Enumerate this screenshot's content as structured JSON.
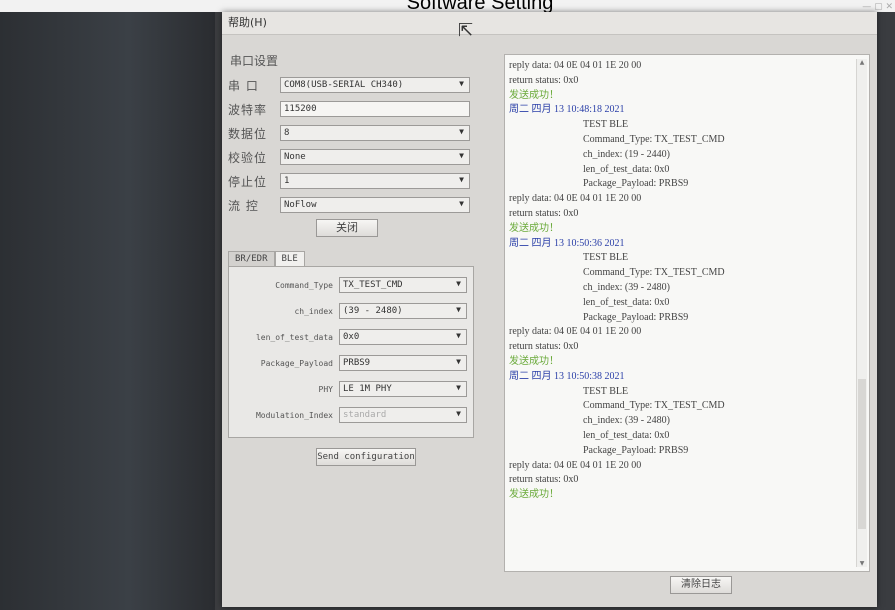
{
  "window": {
    "title": "Software Setting"
  },
  "menubar": {
    "help": "帮助(H)"
  },
  "serial": {
    "group_title": "串口设置",
    "port_label": "串  口",
    "port_value": "COM8(USB-SERIAL CH340)",
    "baud_label": "波特率",
    "baud_value": "115200",
    "databits_label": "数据位",
    "databits_value": "8",
    "parity_label": "校验位",
    "parity_value": "None",
    "stopbits_label": "停止位",
    "stopbits_value": "1",
    "flow_label": "流  控",
    "flow_value": "NoFlow",
    "close_button": "关闭"
  },
  "tabs": [
    {
      "label": "BR/EDR"
    },
    {
      "label": "BLE"
    }
  ],
  "ble": {
    "fields": [
      {
        "label": "Command_Type",
        "value": "TX_TEST_CMD"
      },
      {
        "label": "ch_index",
        "value": "(39 - 2480)"
      },
      {
        "label": "len_of_test_data",
        "value": "0x0"
      },
      {
        "label": "Package_Payload",
        "value": "PRBS9"
      },
      {
        "label": "PHY",
        "value": "LE 1M PHY"
      },
      {
        "label": "Modulation_Index",
        "value": "standard"
      }
    ],
    "send_button": "Send configuration"
  },
  "log": {
    "lines": [
      {
        "text": "reply data: 04 0E 04 01 1E 20 00",
        "kind": "normal"
      },
      {
        "text": "return status: 0x0",
        "kind": "normal"
      },
      {
        "text": "发送成功！",
        "kind": "ok"
      },
      {
        "text": "周二 四月 13 10:48:18 2021",
        "kind": "ts"
      },
      {
        "text": "TEST BLE",
        "kind": "indent"
      },
      {
        "text": "Command_Type: TX_TEST_CMD",
        "kind": "indent"
      },
      {
        "text": "ch_index: (19 - 2440)",
        "kind": "indent"
      },
      {
        "text": "len_of_test_data: 0x0",
        "kind": "indent"
      },
      {
        "text": "Package_Payload: PRBS9",
        "kind": "indent"
      },
      {
        "text": "reply data: 04 0E 04 01 1E 20 00",
        "kind": "normal"
      },
      {
        "text": "return status: 0x0",
        "kind": "normal"
      },
      {
        "text": "发送成功！",
        "kind": "ok"
      },
      {
        "text": "周二 四月 13 10:50:36 2021",
        "kind": "ts"
      },
      {
        "text": "TEST BLE",
        "kind": "indent"
      },
      {
        "text": "Command_Type: TX_TEST_CMD",
        "kind": "indent"
      },
      {
        "text": "ch_index: (39 - 2480)",
        "kind": "indent"
      },
      {
        "text": "len_of_test_data: 0x0",
        "kind": "indent"
      },
      {
        "text": "Package_Payload: PRBS9",
        "kind": "indent"
      },
      {
        "text": "reply data: 04 0E 04 01 1E 20 00",
        "kind": "normal"
      },
      {
        "text": "return status: 0x0",
        "kind": "normal"
      },
      {
        "text": "发送成功！",
        "kind": "ok"
      },
      {
        "text": "周二 四月 13 10:50:38 2021",
        "kind": "ts"
      },
      {
        "text": "TEST BLE",
        "kind": "indent"
      },
      {
        "text": "Command_Type: TX_TEST_CMD",
        "kind": "indent"
      },
      {
        "text": "ch_index: (39 - 2480)",
        "kind": "indent"
      },
      {
        "text": "len_of_test_data: 0x0",
        "kind": "indent"
      },
      {
        "text": "Package_Payload: PRBS9",
        "kind": "indent"
      },
      {
        "text": "reply data: 04 0E 04 01 1E 20 00",
        "kind": "normal"
      },
      {
        "text": "return status: 0x0",
        "kind": "normal"
      },
      {
        "text": "发送成功！",
        "kind": "ok"
      }
    ],
    "clear_button": "清除日志"
  },
  "colors": {
    "ok": "#6aaa3a",
    "timestamp": "#2a3fa8"
  }
}
